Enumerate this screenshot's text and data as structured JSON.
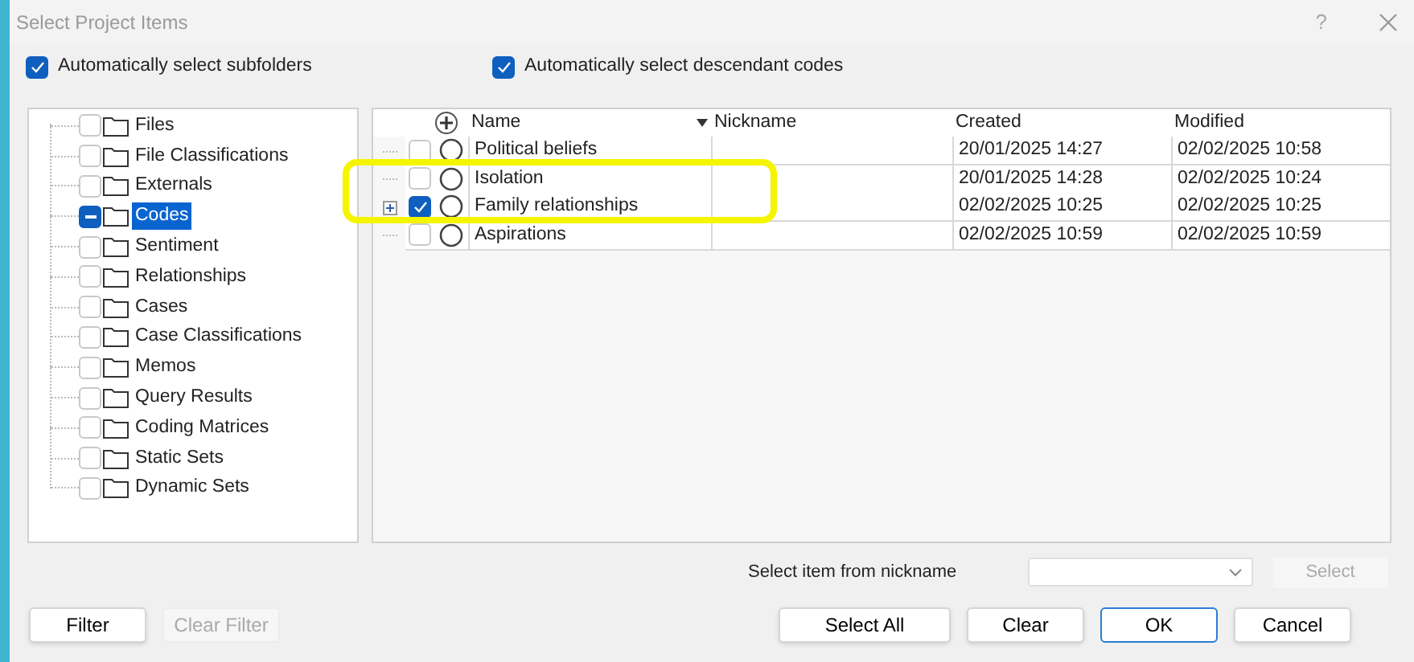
{
  "window": {
    "title": "Select Project Items",
    "help": "?"
  },
  "options": [
    {
      "label": "Automatically select subfolders",
      "checked": true
    },
    {
      "label": "Automatically select descendant codes",
      "checked": true
    }
  ],
  "folders": [
    {
      "label": "Files",
      "checked": false,
      "partial": false,
      "selected": false
    },
    {
      "label": "File Classifications",
      "checked": false,
      "partial": false,
      "selected": false
    },
    {
      "label": "Externals",
      "checked": false,
      "partial": false,
      "selected": false
    },
    {
      "label": "Codes",
      "checked": false,
      "partial": true,
      "selected": true
    },
    {
      "label": "Sentiment",
      "checked": false,
      "partial": false,
      "selected": false
    },
    {
      "label": "Relationships",
      "checked": false,
      "partial": false,
      "selected": false
    },
    {
      "label": "Cases",
      "checked": false,
      "partial": false,
      "selected": false
    },
    {
      "label": "Case Classifications",
      "checked": false,
      "partial": false,
      "selected": false
    },
    {
      "label": "Memos",
      "checked": false,
      "partial": false,
      "selected": false
    },
    {
      "label": "Query Results",
      "checked": false,
      "partial": false,
      "selected": false
    },
    {
      "label": "Coding Matrices",
      "checked": false,
      "partial": false,
      "selected": false
    },
    {
      "label": "Static Sets",
      "checked": false,
      "partial": false,
      "selected": false
    },
    {
      "label": "Dynamic Sets",
      "checked": false,
      "partial": false,
      "selected": false
    }
  ],
  "table": {
    "columns": [
      "Name",
      "Nickname",
      "Created",
      "Modified"
    ],
    "rows": [
      {
        "name": "Political beliefs",
        "created": "20/01/2025 14:27",
        "modified": "02/02/2025 10:58",
        "checked": false,
        "expandable": false
      },
      {
        "name": "Isolation",
        "created": "20/01/2025 14:28",
        "modified": "02/02/2025 10:24",
        "checked": false,
        "expandable": false
      },
      {
        "name": "Family relationships",
        "created": "02/02/2025 10:25",
        "modified": "02/02/2025 10:25",
        "checked": true,
        "expandable": true
      },
      {
        "name": "Aspirations",
        "created": "02/02/2025 10:59",
        "modified": "02/02/2025 10:59",
        "checked": false,
        "expandable": false
      }
    ]
  },
  "nickname_select": {
    "label": "Select item from nickname",
    "button": {
      "label": "Select",
      "disabled": true
    }
  },
  "left_buttons": [
    {
      "label": "Filter",
      "disabled": false
    },
    {
      "label": "Clear Filter",
      "disabled": true
    }
  ],
  "right_buttons": [
    {
      "label": "Select All",
      "disabled": false,
      "selected": false
    },
    {
      "label": "Clear",
      "disabled": false,
      "selected": false
    },
    {
      "label": "OK",
      "disabled": false,
      "selected": true
    },
    {
      "label": "Cancel",
      "disabled": false,
      "selected": false
    }
  ]
}
